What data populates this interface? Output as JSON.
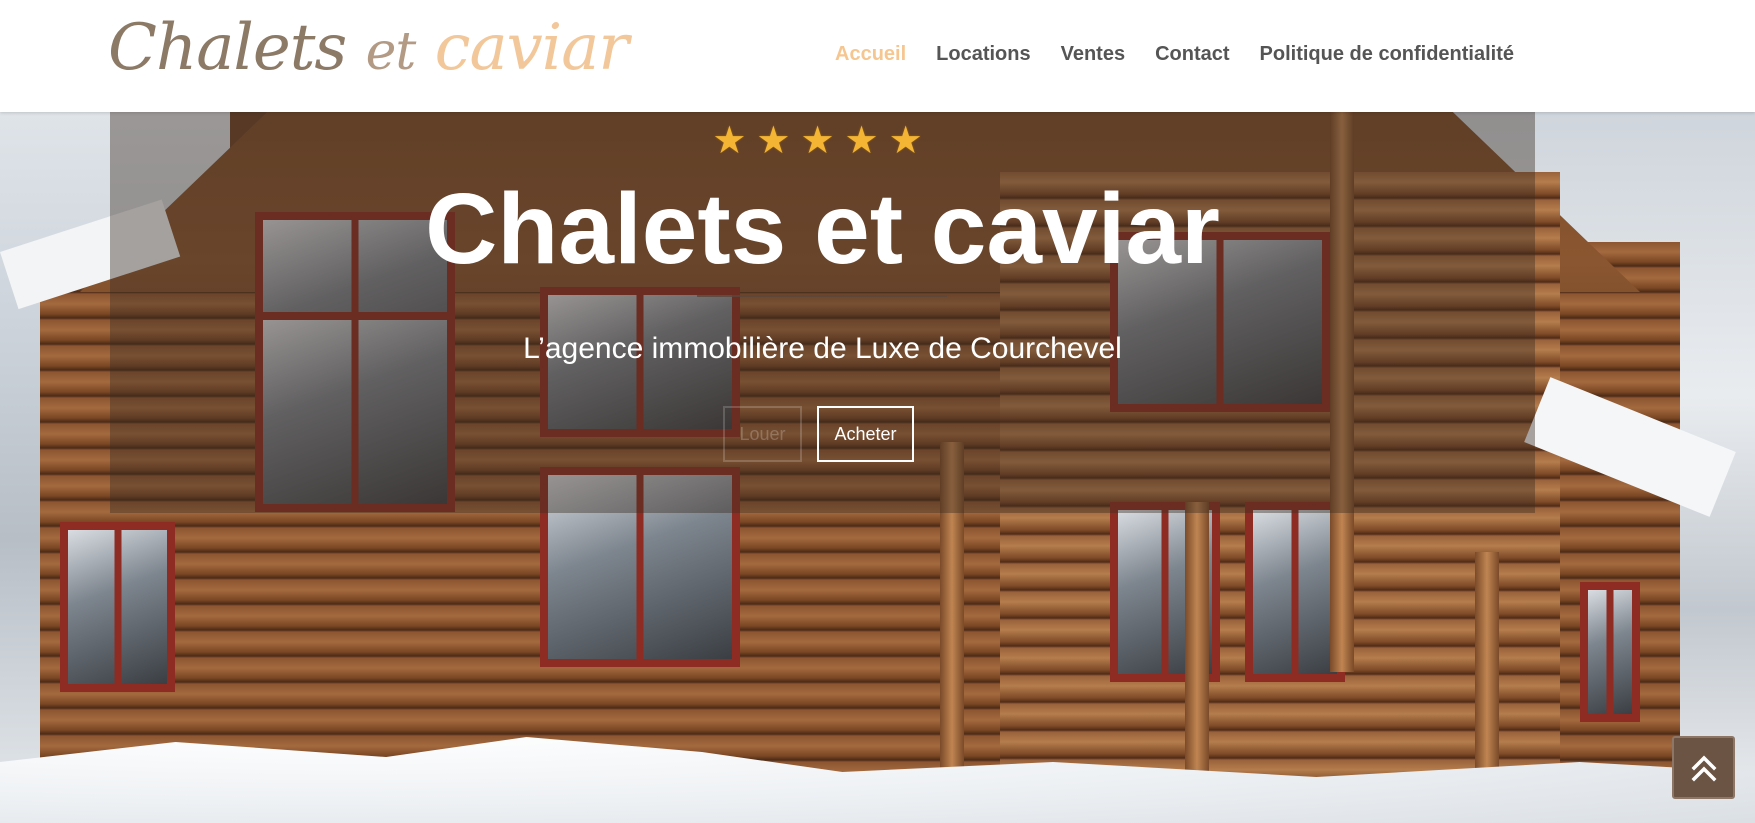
{
  "header": {
    "logo": {
      "word1": "Chalets",
      "word2": "et",
      "word3": "caviar"
    },
    "nav": [
      {
        "label": "Accueil",
        "active": true
      },
      {
        "label": "Locations",
        "active": false
      },
      {
        "label": "Ventes",
        "active": false
      },
      {
        "label": "Contact",
        "active": false
      },
      {
        "label": "Politique de confidentialité",
        "active": false
      }
    ]
  },
  "hero": {
    "stars": "★★★★★",
    "rating": 5,
    "title": "Chalets et caviar",
    "subtitle": "L’agence immobilière de Luxe de Courchevel",
    "buttons": {
      "louer": "Louer",
      "acheter": "Acheter"
    }
  },
  "scroll_top": {
    "icon": "double-chevron-up-icon"
  },
  "colors": {
    "accent": "#f6c690",
    "nav_text": "#555555",
    "logo_dark": "#8c7966",
    "logo_light": "#f2c79a",
    "star": "#f3b533",
    "scroll_button": "#6b5443"
  }
}
